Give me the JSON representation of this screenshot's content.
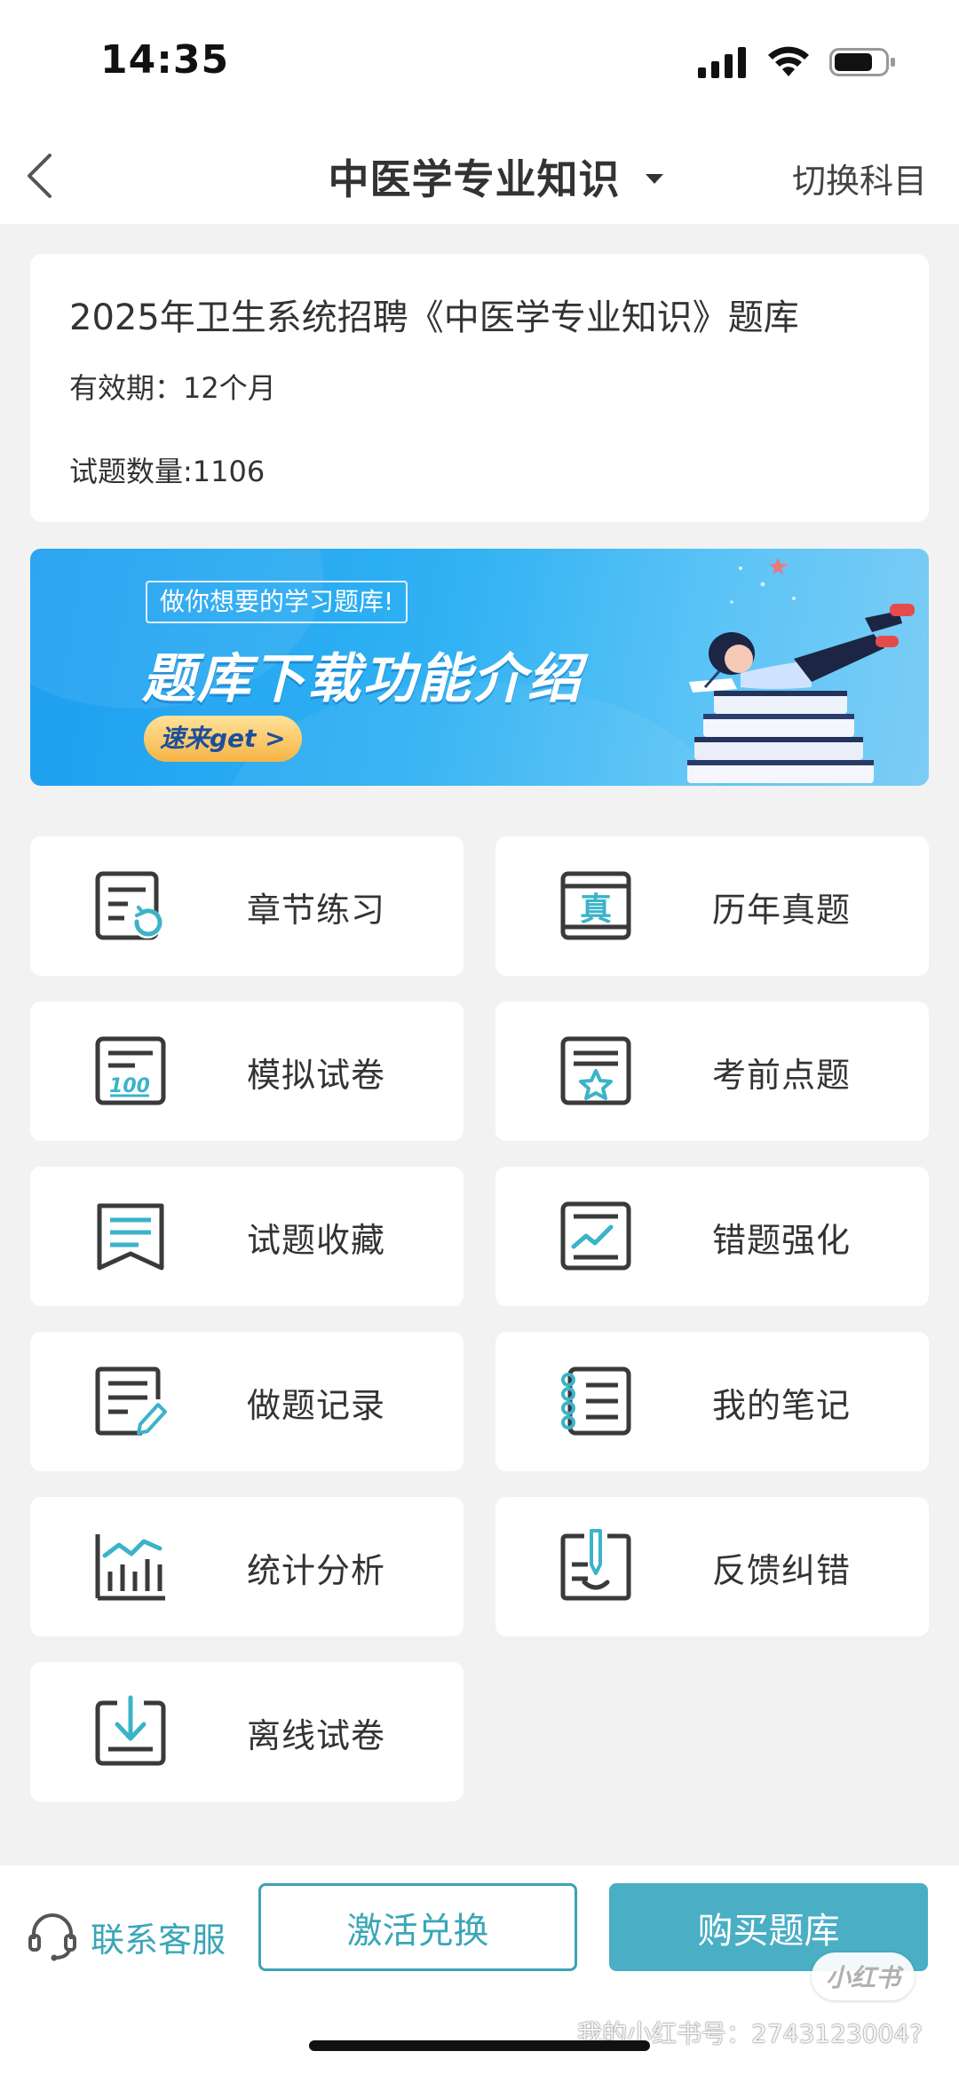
{
  "status_bar": {
    "time": "14:35"
  },
  "nav": {
    "title": "中医学专业知识",
    "switch_label": "切换科目"
  },
  "info_card": {
    "title": "2025年卫生系统招聘《中医学专业知识》题库",
    "validity": "有效期：12个月",
    "question_count": "试题数量:1106"
  },
  "banner": {
    "tag": "做你想要的学习题库!",
    "headline": "题库下载功能介绍",
    "cta": "速来get >"
  },
  "menu": [
    {
      "label": "章节练习",
      "icon": "chapter-practice-icon"
    },
    {
      "label": "历年真题",
      "icon": "past-exams-icon"
    },
    {
      "label": "模拟试卷",
      "icon": "mock-exam-icon"
    },
    {
      "label": "考前点题",
      "icon": "key-questions-icon"
    },
    {
      "label": "试题收藏",
      "icon": "favorites-icon"
    },
    {
      "label": "错题强化",
      "icon": "wrong-questions-icon"
    },
    {
      "label": "做题记录",
      "icon": "practice-record-icon"
    },
    {
      "label": "我的笔记",
      "icon": "notes-icon"
    },
    {
      "label": "统计分析",
      "icon": "statistics-icon"
    },
    {
      "label": "反馈纠错",
      "icon": "feedback-icon"
    },
    {
      "label": "离线试卷",
      "icon": "offline-download-icon"
    }
  ],
  "bottom_bar": {
    "service_label": "联系客服",
    "activate_label": "激活兑换",
    "buy_label": "购买题库"
  },
  "overlay": {
    "badge": "小红书",
    "watermark": "我的小红书号：2743123004?"
  },
  "colors": {
    "accent": "#3aa6b8",
    "icon_dark": "#3a3a3a",
    "icon_teal": "#3bb3c9"
  }
}
